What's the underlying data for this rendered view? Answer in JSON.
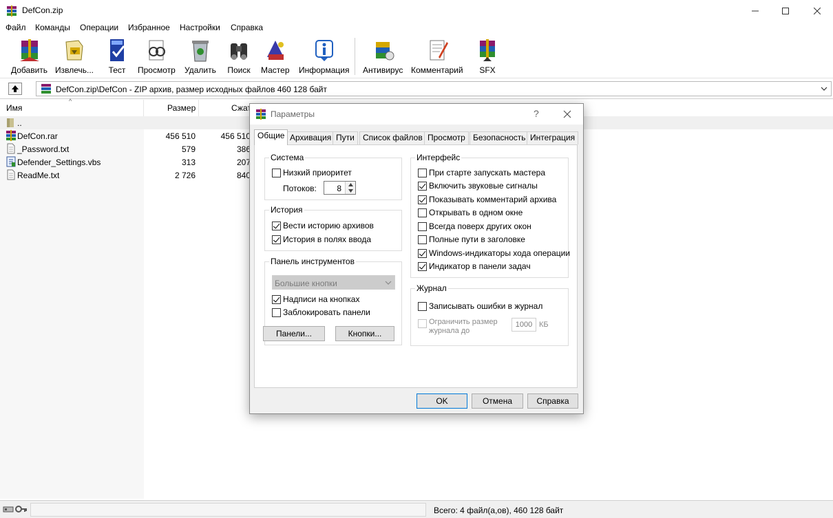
{
  "window": {
    "title": "DefCon.zip"
  },
  "menu": [
    "Файл",
    "Команды",
    "Операции",
    "Избранное",
    "Настройки",
    "Справка"
  ],
  "toolbar": [
    {
      "label": "Добавить",
      "icon": "add-archive-icon"
    },
    {
      "label": "Извлечь...",
      "icon": "extract-icon"
    },
    {
      "label": "Тест",
      "icon": "test-icon"
    },
    {
      "label": "Просмотр",
      "icon": "view-icon"
    },
    {
      "label": "Удалить",
      "icon": "delete-icon"
    },
    {
      "label": "Поиск",
      "icon": "find-icon"
    },
    {
      "label": "Мастер",
      "icon": "wizard-icon"
    },
    {
      "label": "Информация",
      "icon": "info-icon"
    },
    {
      "label": "Антивирус",
      "icon": "antivirus-icon"
    },
    {
      "label": "Комментарий",
      "icon": "comment-icon"
    },
    {
      "label": "SFX",
      "icon": "sfx-icon"
    }
  ],
  "address": {
    "path": "DefCon.zip\\DefCon - ZIP архив, размер исходных файлов 460 128 байт"
  },
  "filelist": {
    "columns": [
      "Имя",
      "Размер",
      "Сжат"
    ],
    "rows": [
      {
        "name": "..",
        "size": "",
        "packed": "",
        "icon": "folder-up-icon"
      },
      {
        "name": "DefCon.rar",
        "size": "456 510",
        "packed": "456 510",
        "icon": "rar-file-icon"
      },
      {
        "name": "_Password.txt",
        "size": "579",
        "packed": "386",
        "icon": "text-file-icon"
      },
      {
        "name": "Defender_Settings.vbs",
        "size": "313",
        "packed": "207",
        "icon": "script-file-icon"
      },
      {
        "name": "ReadMe.txt",
        "size": "2 726",
        "packed": "840",
        "icon": "text-file-icon"
      }
    ]
  },
  "status": {
    "text": "Всего: 4 файл(а,ов), 460 128 байт"
  },
  "dialog": {
    "title": "Параметры",
    "help": "?",
    "tabs": [
      "Общие",
      "Архивация",
      "Пути",
      "Список файлов",
      "Просмотр",
      "Безопасность",
      "Интеграция"
    ],
    "system": {
      "title": "Система",
      "low_priority": "Низкий приоритет",
      "threads_label": "Потоков:",
      "threads_value": "8"
    },
    "history": {
      "title": "История",
      "items": [
        "Вести историю архивов",
        "История в полях ввода"
      ]
    },
    "toolbar_panel": {
      "title": "Панель инструментов",
      "size_select": "Большие кнопки",
      "labels_on_buttons": "Надписи на кнопках",
      "lock_panels": "Заблокировать панели",
      "panels_button": "Панели...",
      "buttons_button": "Кнопки..."
    },
    "interface": {
      "title": "Интерфейс",
      "items": [
        {
          "label": "При старте запускать мастера",
          "checked": false
        },
        {
          "label": "Включить звуковые сигналы",
          "checked": true
        },
        {
          "label": "Показывать комментарий архива",
          "checked": true
        },
        {
          "label": "Открывать в одном окне",
          "checked": false
        },
        {
          "label": "Всегда поверх других окон",
          "checked": false
        },
        {
          "label": "Полные пути в заголовке",
          "checked": false
        },
        {
          "label": "Windows-индикаторы хода операции",
          "checked": true
        },
        {
          "label": "Индикатор в панели задач",
          "checked": true
        }
      ]
    },
    "log": {
      "title": "Журнал",
      "write_errors": "Записывать ошибки в журнал",
      "limit_line1": "Ограничить размер",
      "limit_line2": "журнала до",
      "limit_value": "1000",
      "limit_unit": "КБ"
    },
    "buttons": {
      "ok": "OK",
      "cancel": "Отмена",
      "help": "Справка"
    }
  }
}
